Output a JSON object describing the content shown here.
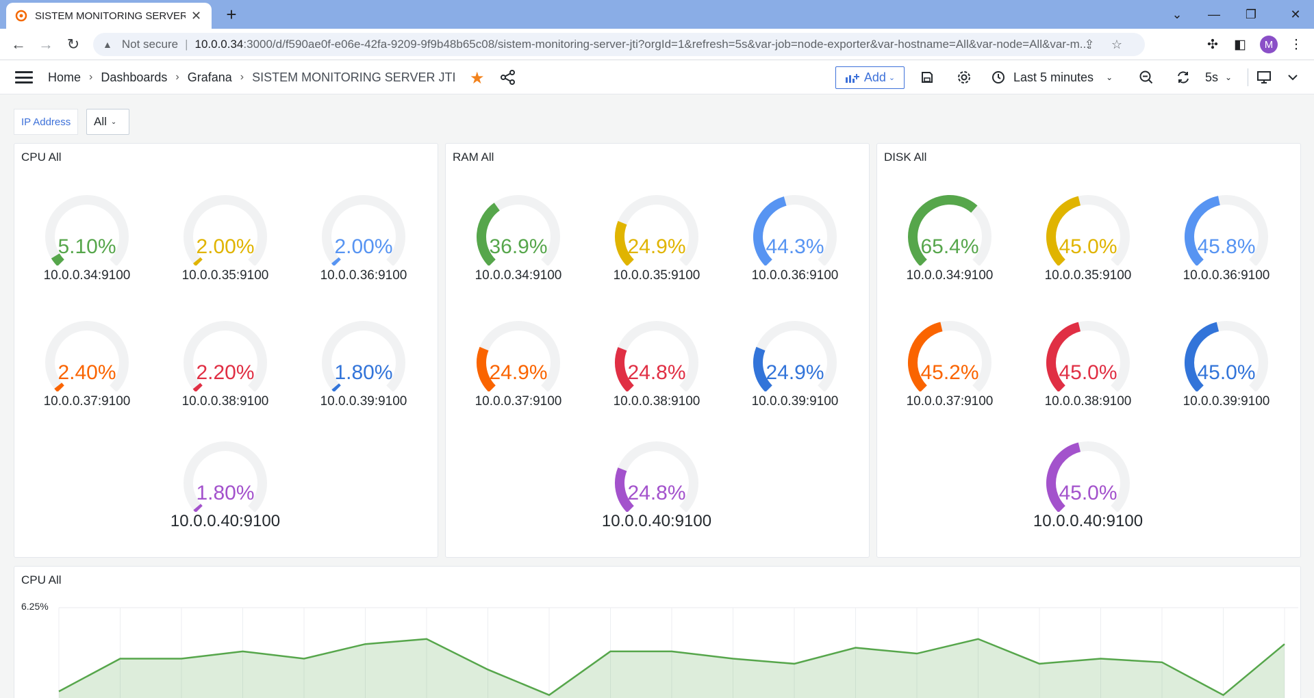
{
  "browser": {
    "tab_title": "SISTEM MONITORING SERVER JTI",
    "not_secure": "Not secure",
    "url_host": "10.0.0.34",
    "url_rest": ":3000/d/f590ae0f-e06e-42fa-9209-9f9b48b65c08/sistem-monitoring-server-jti?orgId=1&refresh=5s&var-job=node-exporter&var-hostname=All&var-node=All&var-m...",
    "profile_initial": "M"
  },
  "nav": {
    "breadcrumbs": [
      "Home",
      "Dashboards",
      "Grafana",
      "SISTEM MONITORING SERVER JTI"
    ],
    "add_label": "Add",
    "time_range": "Last 5 minutes",
    "refresh_interval": "5s"
  },
  "variables": {
    "ip_label": "IP Address",
    "ip_value": "All"
  },
  "panels": {
    "cpu": {
      "title": "CPU All",
      "gauges": [
        {
          "host": "10.0.0.34:9100",
          "value": "5.10%",
          "level": 5.1,
          "color": "#56a64b"
        },
        {
          "host": "10.0.0.35:9100",
          "value": "2.00%",
          "level": 2.0,
          "color": "#e0b400"
        },
        {
          "host": "10.0.0.36:9100",
          "value": "2.00%",
          "level": 2.0,
          "color": "#5794f2"
        },
        {
          "host": "10.0.0.37:9100",
          "value": "2.40%",
          "level": 2.4,
          "color": "#fa6400"
        },
        {
          "host": "10.0.0.38:9100",
          "value": "2.20%",
          "level": 2.2,
          "color": "#e02f44"
        },
        {
          "host": "10.0.0.39:9100",
          "value": "1.80%",
          "level": 1.8,
          "color": "#3274d9"
        },
        {
          "host": "10.0.0.40:9100",
          "value": "1.80%",
          "level": 1.8,
          "color": "#a352cc"
        }
      ]
    },
    "ram": {
      "title": "RAM All",
      "gauges": [
        {
          "host": "10.0.0.34:9100",
          "value": "36.9%",
          "level": 36.9,
          "color": "#56a64b"
        },
        {
          "host": "10.0.0.35:9100",
          "value": "24.9%",
          "level": 24.9,
          "color": "#e0b400"
        },
        {
          "host": "10.0.0.36:9100",
          "value": "44.3%",
          "level": 44.3,
          "color": "#5794f2"
        },
        {
          "host": "10.0.0.37:9100",
          "value": "24.9%",
          "level": 24.9,
          "color": "#fa6400"
        },
        {
          "host": "10.0.0.38:9100",
          "value": "24.8%",
          "level": 24.8,
          "color": "#e02f44"
        },
        {
          "host": "10.0.0.39:9100",
          "value": "24.9%",
          "level": 24.9,
          "color": "#3274d9"
        },
        {
          "host": "10.0.0.40:9100",
          "value": "24.8%",
          "level": 24.8,
          "color": "#a352cc"
        }
      ]
    },
    "disk": {
      "title": "DISK All",
      "gauges": [
        {
          "host": "10.0.0.34:9100",
          "value": "65.4%",
          "level": 65.4,
          "color": "#56a64b"
        },
        {
          "host": "10.0.0.35:9100",
          "value": "45.0%",
          "level": 45.0,
          "color": "#e0b400"
        },
        {
          "host": "10.0.0.36:9100",
          "value": "45.8%",
          "level": 45.8,
          "color": "#5794f2"
        },
        {
          "host": "10.0.0.37:9100",
          "value": "45.2%",
          "level": 45.2,
          "color": "#fa6400"
        },
        {
          "host": "10.0.0.38:9100",
          "value": "45.0%",
          "level": 45.0,
          "color": "#e02f44"
        },
        {
          "host": "10.0.0.39:9100",
          "value": "45.0%",
          "level": 45.0,
          "color": "#3274d9"
        },
        {
          "host": "10.0.0.40:9100",
          "value": "45.0%",
          "level": 45.0,
          "color": "#a352cc"
        }
      ]
    },
    "gauge_min": "0",
    "gauge_max": "100"
  },
  "cpu_timeseries": {
    "title": "CPU All"
  },
  "chart_data": {
    "type": "area",
    "title": "CPU All",
    "y_tick_label": "6.25%",
    "color": "#56a64b",
    "values": [
      5.1,
      5.55,
      5.55,
      5.65,
      5.55,
      5.75,
      5.82,
      5.4,
      5.05,
      5.65,
      5.65,
      5.55,
      5.48,
      5.7,
      5.62,
      5.82,
      5.48,
      5.55,
      5.5,
      5.05,
      5.75
    ],
    "visible_top_value": 6.25,
    "visible_bottom_value": 5.0
  }
}
